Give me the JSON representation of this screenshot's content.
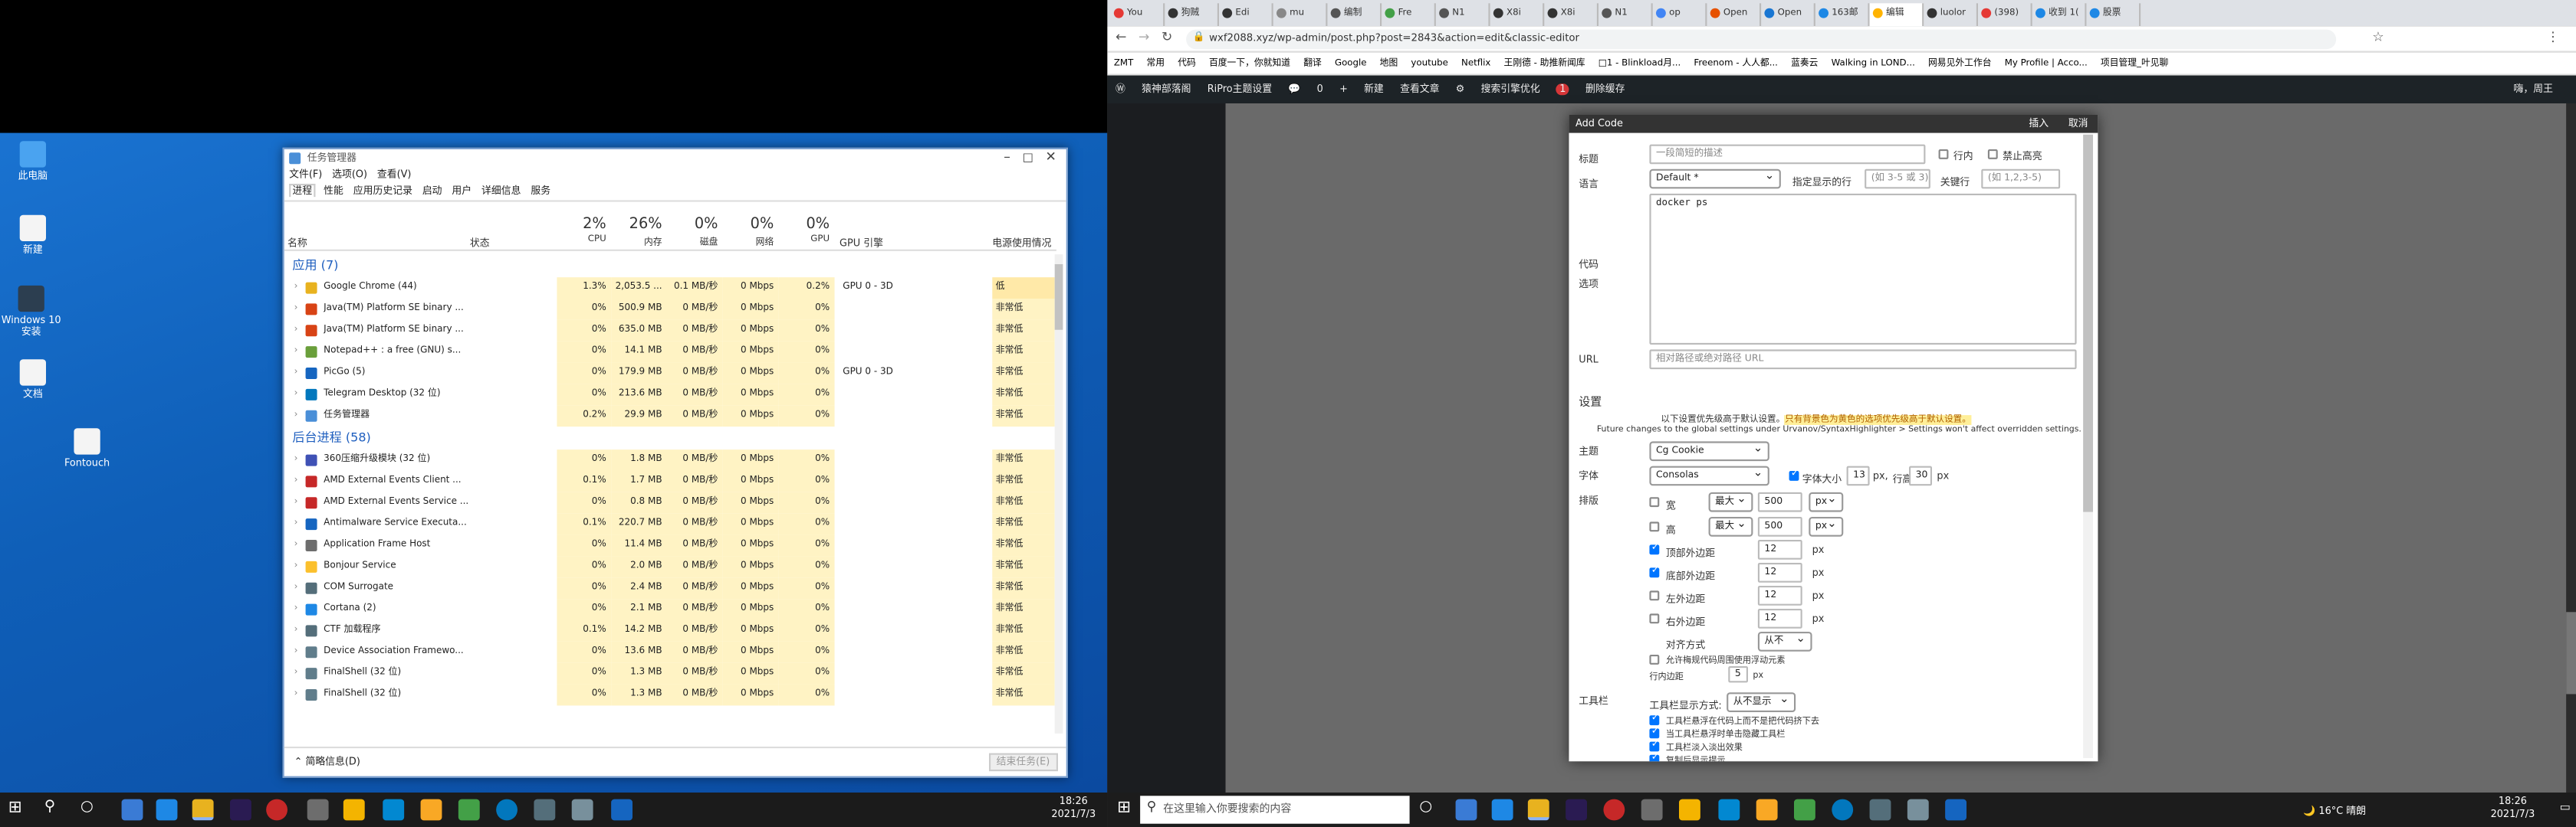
{
  "desktop_icons": [
    "此电脑",
    "新建",
    "Windows 10 安装",
    "文档",
    "Fontouch"
  ],
  "taskbar_left": {
    "time": "18:26",
    "date": "2021/7/3",
    "search_label": "搜索"
  },
  "taskmanager": {
    "title": "任务管理器",
    "menu": [
      "文件(F)",
      "选项(O)",
      "查看(V)"
    ],
    "tabs": [
      "进程",
      "性能",
      "应用历史记录",
      "启动",
      "用户",
      "详细信息",
      "服务"
    ],
    "columns": {
      "name": "名称",
      "status": "状态",
      "cpu_pct": "2%",
      "cpu": "CPU",
      "mem_pct": "26%",
      "mem": "内存",
      "disk_pct": "0%",
      "disk": "磁盘",
      "net_pct": "0%",
      "net": "网络",
      "gpu_pct": "0%",
      "gpu": "GPU",
      "gpu_engine": "GPU 引擎",
      "power": "电源使用情况"
    },
    "apps_section": "应用 (7)",
    "apps": [
      {
        "name": "Google Chrome (44)",
        "cpu": "1.3%",
        "mem": "2,053.5 ...",
        "disk": "0.1 MB/秒",
        "net": "0 Mbps",
        "gpu": "0.2%",
        "eng": "GPU 0 - 3D",
        "pwr": "低"
      },
      {
        "name": "Java(TM) Platform SE binary ...",
        "cpu": "0%",
        "mem": "500.9 MB",
        "disk": "0 MB/秒",
        "net": "0 Mbps",
        "gpu": "0%",
        "eng": "",
        "pwr": "非常低"
      },
      {
        "name": "Java(TM) Platform SE binary ...",
        "cpu": "0%",
        "mem": "635.0 MB",
        "disk": "0 MB/秒",
        "net": "0 Mbps",
        "gpu": "0%",
        "eng": "",
        "pwr": "非常低"
      },
      {
        "name": "Notepad++ : a free (GNU) s...",
        "cpu": "0%",
        "mem": "14.1 MB",
        "disk": "0 MB/秒",
        "net": "0 Mbps",
        "gpu": "0%",
        "eng": "",
        "pwr": "非常低"
      },
      {
        "name": "PicGo (5)",
        "cpu": "0%",
        "mem": "179.9 MB",
        "disk": "0 MB/秒",
        "net": "0 Mbps",
        "gpu": "0%",
        "eng": "GPU 0 - 3D",
        "pwr": "非常低"
      },
      {
        "name": "Telegram Desktop (32 位)",
        "cpu": "0%",
        "mem": "213.6 MB",
        "disk": "0 MB/秒",
        "net": "0 Mbps",
        "gpu": "0%",
        "eng": "",
        "pwr": "非常低"
      },
      {
        "name": "任务管理器",
        "cpu": "0.2%",
        "mem": "29.9 MB",
        "disk": "0 MB/秒",
        "net": "0 Mbps",
        "gpu": "0%",
        "eng": "",
        "pwr": "非常低"
      }
    ],
    "bg_section": "后台进程 (58)",
    "bg": [
      {
        "name": "360压缩升级模块 (32 位)",
        "cpu": "0%",
        "mem": "1.8 MB",
        "disk": "0 MB/秒",
        "net": "0 Mbps",
        "gpu": "0%",
        "pwr": "非常低"
      },
      {
        "name": "AMD External Events Client ...",
        "cpu": "0.1%",
        "mem": "1.7 MB",
        "disk": "0 MB/秒",
        "net": "0 Mbps",
        "gpu": "0%",
        "pwr": "非常低"
      },
      {
        "name": "AMD External Events Service ...",
        "cpu": "0%",
        "mem": "0.8 MB",
        "disk": "0 MB/秒",
        "net": "0 Mbps",
        "gpu": "0%",
        "pwr": "非常低"
      },
      {
        "name": "Antimalware Service Executa...",
        "cpu": "0.1%",
        "mem": "220.7 MB",
        "disk": "0 MB/秒",
        "net": "0 Mbps",
        "gpu": "0%",
        "pwr": "非常低"
      },
      {
        "name": "Application Frame Host",
        "cpu": "0%",
        "mem": "11.4 MB",
        "disk": "0 MB/秒",
        "net": "0 Mbps",
        "gpu": "0%",
        "pwr": "非常低"
      },
      {
        "name": "Bonjour Service",
        "cpu": "0%",
        "mem": "2.0 MB",
        "disk": "0 MB/秒",
        "net": "0 Mbps",
        "gpu": "0%",
        "pwr": "非常低"
      },
      {
        "name": "COM Surrogate",
        "cpu": "0%",
        "mem": "2.4 MB",
        "disk": "0 MB/秒",
        "net": "0 Mbps",
        "gpu": "0%",
        "pwr": "非常低"
      },
      {
        "name": "Cortana (2)",
        "cpu": "0%",
        "mem": "2.1 MB",
        "disk": "0 MB/秒",
        "net": "0 Mbps",
        "gpu": "0%",
        "pwr": "非常低"
      },
      {
        "name": "CTF 加载程序",
        "cpu": "0.1%",
        "mem": "14.2 MB",
        "disk": "0 MB/秒",
        "net": "0 Mbps",
        "gpu": "0%",
        "pwr": "非常低"
      },
      {
        "name": "Device Association Framewo...",
        "cpu": "0%",
        "mem": "13.6 MB",
        "disk": "0 MB/秒",
        "net": "0 Mbps",
        "gpu": "0%",
        "pwr": "非常低"
      },
      {
        "name": "FinalShell (32 位)",
        "cpu": "0%",
        "mem": "1.3 MB",
        "disk": "0 MB/秒",
        "net": "0 Mbps",
        "gpu": "0%",
        "pwr": "非常低"
      },
      {
        "name": "FinalShell (32 位)",
        "cpu": "0%",
        "mem": "1.3 MB",
        "disk": "0 MB/秒",
        "net": "0 Mbps",
        "gpu": "0%",
        "pwr": "非常低"
      }
    ],
    "footer": "简略信息(D)",
    "end_task": "结束任务(E)"
  },
  "browser": {
    "tabs": [
      "You",
      "狗贼",
      "Edi",
      "mu",
      "编制",
      "Fre",
      "N1",
      "X8i",
      "X8i",
      "N1",
      "op",
      "Open",
      "Open",
      "163邮",
      "编辑",
      "luolor",
      "(398)",
      "收到 1(",
      "股票"
    ],
    "url": "wxf2088.xyz/wp-admin/post.php?post=2843&action=edit&classic-editor",
    "bookmarks": [
      "ZMT",
      "常用",
      "代码",
      "百度一下，你就知道",
      "翻译",
      "Google",
      "地图",
      "youtube",
      "Netflix",
      "王刚德 - 助推新闻库",
      "□1 - Blinkload月...",
      "Freenom - 人人都...",
      "蓝奏云",
      "Walking in LOND...",
      "网易见外工作台",
      "My Profile | Acco...",
      "项目管理_叶见聊"
    ]
  },
  "wpbar": [
    "猿神部落阁",
    "RiPro主题设置",
    "0",
    "新建",
    "查看文章",
    "搜索引擎优化",
    "1",
    "删除缓存",
    "嗨，周王"
  ],
  "dialog": {
    "title": "Add Code",
    "insert": "插入",
    "cancel": "取消",
    "label_title": "标题",
    "ph_title": "一段简短的描述",
    "cb_inline": "行内",
    "cb_nohl": "禁止高亮",
    "label_lang": "语言",
    "lang_value": "Default *",
    "label_mark": "指定显示的行",
    "ph_mark": "(如 3-5 或 3)",
    "label_key": "关键行",
    "ph_key": "(如 1,2,3-5)",
    "label_code": "代码",
    "label_opts": "选项",
    "code_value": "docker ps",
    "label_url": "URL",
    "ph_url": "相对路径或绝对路径 URL",
    "settings": "设置",
    "note1": "以下设置优先级高于默认设置。",
    "note1b": "只有背景色为黄色的选项优先级高于默认设置。",
    "note2": "Future changes to the global settings under Urvanov/SyntaxHighlighter > Settings won't affect overridden settings.",
    "label_theme": "主题",
    "theme": "Cg Cookie",
    "label_font": "字体",
    "font": "Consolas",
    "font_size_label": "字体大小",
    "font_size": "13",
    "px1": "px,",
    "line_h_label": "行高",
    "line_h": "30",
    "px2": "px",
    "label_layout": "排版",
    "w_label": "宽",
    "w_mode": "最大",
    "w_val": "500",
    "w_unit": "px",
    "h_label": "高",
    "h_mode": "最大",
    "h_val": "500",
    "h_unit": "px",
    "top_m": "顶部外边距",
    "top_v": "12",
    "bot_m": "底部外边距",
    "bot_v": "12",
    "left_m": "左外边距",
    "left_v": "12",
    "right_m": "右外边距",
    "right_v": "12",
    "px": "px",
    "align_label": "对齐方式",
    "align": "从不",
    "float_label": "允许梅规代码周围使用浮动元素",
    "indent_label": "行内边距",
    "indent_v": "5",
    "label_toolbar": "工具栏",
    "tb_mode_label": "工具栏显示方式:",
    "tb_mode": "从不显示",
    "tb1": "工具栏悬浮在代码上而不是把代码挤下去",
    "tb2": "当工具栏悬浮时单击隐藏工具栏",
    "tb3": "工具栏淡入淡出效果",
    "tb4": "复制后显示提示"
  },
  "taskbar_right": {
    "search": "在这里输入你要搜索的内容",
    "weather": "16°C 晴朗",
    "time": "18:26",
    "date": "2021/7/3"
  }
}
